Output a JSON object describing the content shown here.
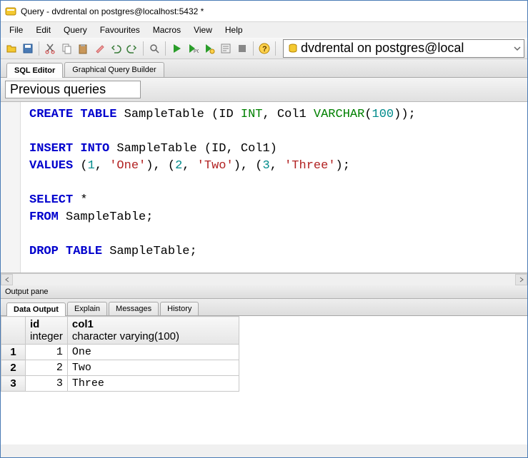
{
  "window": {
    "title": "Query - dvdrental on postgres@localhost:5432 *"
  },
  "menu": {
    "items": [
      "File",
      "Edit",
      "Query",
      "Favourites",
      "Macros",
      "View",
      "Help"
    ]
  },
  "toolbar": {
    "buttons": [
      "open",
      "save",
      "cut",
      "copy",
      "paste",
      "clear",
      "undo",
      "redo",
      "find",
      "run",
      "run-pgscript",
      "run-single",
      "stop",
      "help"
    ],
    "connection": "dvdrental on postgres@local"
  },
  "editorTabs": {
    "items": [
      "SQL Editor",
      "Graphical Query Builder"
    ],
    "active": 0
  },
  "prevQueries": {
    "label": "Previous queries"
  },
  "sql": {
    "l1a": "CREATE",
    "l1b": "TABLE",
    "l1c": " SampleTable (ID ",
    "l1d": "INT",
    "l1e": ", Col1 ",
    "l1f": "VARCHAR",
    "l1g": "(",
    "l1h": "100",
    "l1i": "));",
    "l2a": "INSERT",
    "l2b": "INTO",
    "l2c": " SampleTable (ID, Col1)",
    "l3a": "VALUES",
    "l3b": " (",
    "l3n1": "1",
    "l3c": ", ",
    "l3s1": "'One'",
    "l3d": "), (",
    "l3n2": "2",
    "l3e": ", ",
    "l3s2": "'Two'",
    "l3f": "), (",
    "l3n3": "3",
    "l3g": ", ",
    "l3s3": "'Three'",
    "l3h": ");",
    "l4a": "SELECT",
    "l4b": " *",
    "l5a": "FROM",
    "l5b": " SampleTable;",
    "l6a": "DROP",
    "l6b": "TABLE",
    "l6c": " SampleTable;"
  },
  "outputPane": {
    "title": "Output pane"
  },
  "outTabs": {
    "items": [
      "Data Output",
      "Explain",
      "Messages",
      "History"
    ],
    "active": 0
  },
  "grid": {
    "columns": [
      {
        "name": "id",
        "type": "integer"
      },
      {
        "name": "col1",
        "type": "character varying(100)"
      }
    ],
    "rows": [
      {
        "n": "1",
        "id": "1",
        "col1": "One"
      },
      {
        "n": "2",
        "id": "2",
        "col1": "Two"
      },
      {
        "n": "3",
        "id": "3",
        "col1": "Three"
      }
    ]
  }
}
